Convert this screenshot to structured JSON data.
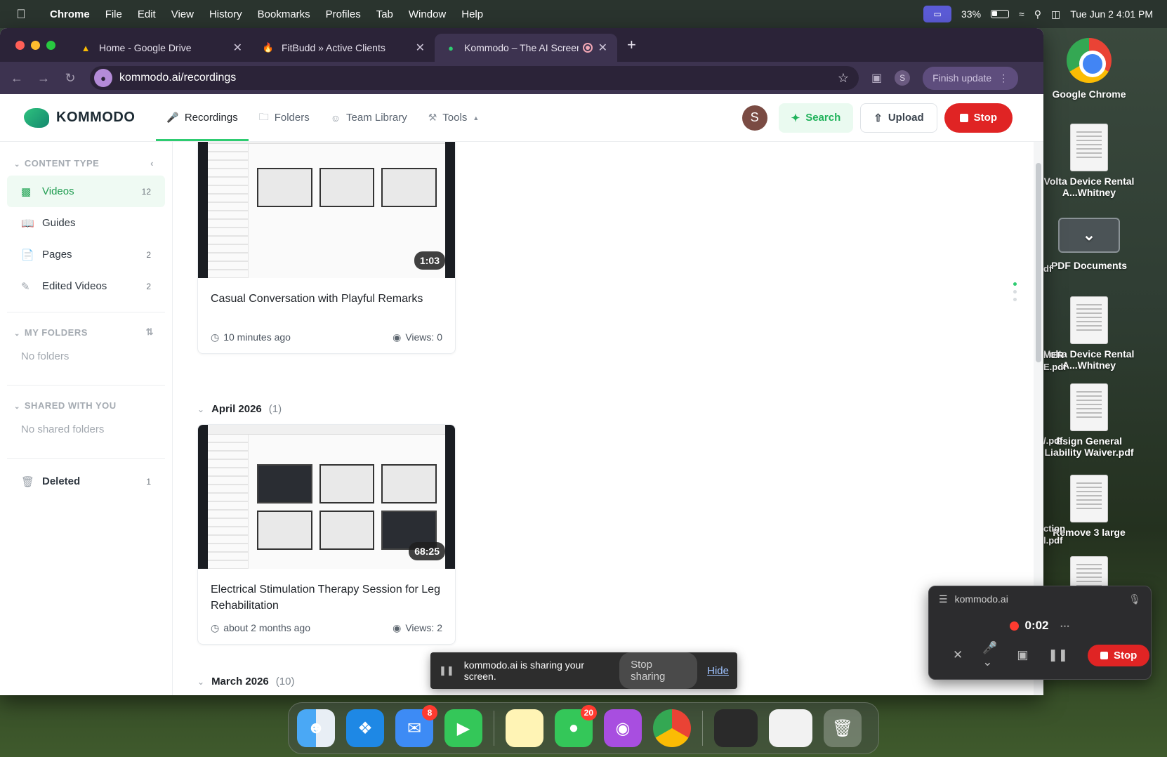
{
  "menubar": {
    "app": "Chrome",
    "items": [
      "File",
      "Edit",
      "View",
      "History",
      "Bookmarks",
      "Profiles",
      "Tab",
      "Window",
      "Help"
    ],
    "battery": "33%",
    "datetime": "Tue Jun 2  4:01 PM"
  },
  "browser": {
    "tabs": [
      {
        "label": "Home - Google Drive",
        "icon": "google-drive-icon"
      },
      {
        "label": "FitBudd » Active Clients",
        "icon": "fitbudd-icon"
      },
      {
        "label": "Kommodo – The AI Screen",
        "icon": "kommodo-icon",
        "active": true
      }
    ],
    "url": "kommodo.ai/recordings",
    "profile_initial": "S",
    "finish_update": "Finish update"
  },
  "header": {
    "brand": "KOMMODO",
    "nav": [
      {
        "label": "Recordings",
        "icon": "mic-icon"
      },
      {
        "label": "Folders",
        "icon": "folder-icon"
      },
      {
        "label": "Team Library",
        "icon": "team-icon"
      },
      {
        "label": "Tools",
        "icon": "tools-icon"
      }
    ],
    "avatar_initial": "S",
    "search_label": "Search",
    "upload_label": "Upload",
    "stop_label": "Stop"
  },
  "sidebar": {
    "content_type_label": "CONTENT TYPE",
    "items": [
      {
        "label": "Videos",
        "count": "12"
      },
      {
        "label": "Guides",
        "count": ""
      },
      {
        "label": "Pages",
        "count": "2"
      },
      {
        "label": "Edited Videos",
        "count": "2"
      }
    ],
    "my_folders_label": "MY FOLDERS",
    "no_folders": "No folders",
    "shared_label": "SHARED WITH YOU",
    "no_shared": "No shared folders",
    "deleted_label": "Deleted",
    "deleted_count": "1"
  },
  "content": {
    "cards": [
      {
        "title": "Casual Conversation with Playful Remarks",
        "duration": "1:03",
        "time": "10 minutes ago",
        "views": "Views: 0"
      },
      {
        "title": "Electrical Stimulation Therapy Session for Leg Rehabilitation",
        "duration": "68:25",
        "time": "about 2 months ago",
        "views": "Views: 2"
      }
    ],
    "groups": [
      {
        "title": "April 2026",
        "count": "(1)"
      },
      {
        "title": "March 2026",
        "count": "(10)"
      }
    ]
  },
  "share_bar": {
    "message": "kommodo.ai is sharing your screen.",
    "stop_sharing": "Stop sharing",
    "hide": "Hide"
  },
  "recorder": {
    "site": "kommodo.ai",
    "timer": "0:02",
    "stop": "Stop"
  },
  "desktop": {
    "icons": [
      {
        "label": "Google Chrome"
      },
      {
        "label": "Volta Device Rental A...Whitney"
      },
      {
        "label": "PDF Documents"
      },
      {
        "label": "Volta Device Rental A...Whitney"
      },
      {
        "label": "Esign General Liability Waiver.pdf"
      },
      {
        "label": "Remove 3 large"
      }
    ],
    "partial": [
      "df",
      "MER",
      "E.pdf",
      "/.pdf",
      "ction",
      "l.pdf"
    ]
  },
  "dock": {
    "mail_badge": "8",
    "messages_badge": "20"
  }
}
